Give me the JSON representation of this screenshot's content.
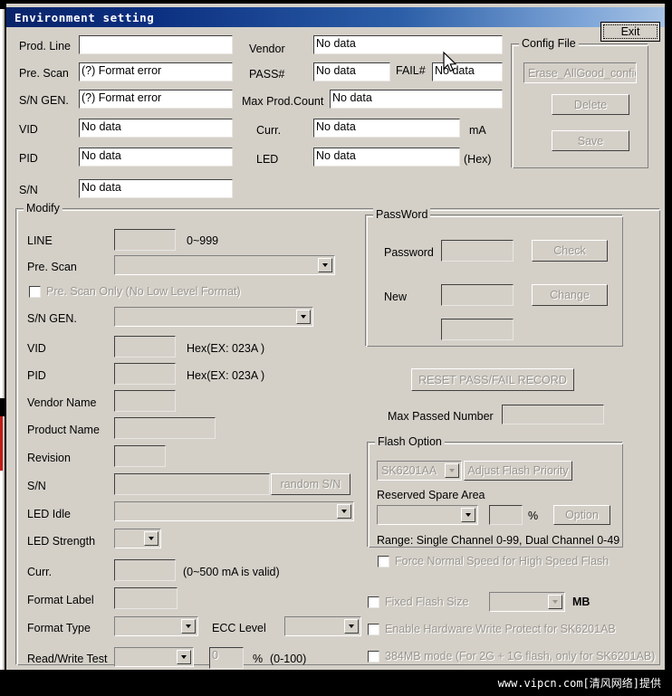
{
  "window": {
    "title": "Environment setting"
  },
  "exit_button": {
    "label": "Exit"
  },
  "top": {
    "prod_line": {
      "label": "Prod. Line",
      "value": ""
    },
    "pre_scan": {
      "label": "Pre. Scan",
      "value": "(?) Format error"
    },
    "sn_gen": {
      "label": "S/N GEN.",
      "value": "(?) Format error"
    },
    "vid": {
      "label": "VID",
      "value": "No data"
    },
    "pid": {
      "label": "PID",
      "value": "No data"
    },
    "sn": {
      "label": "S/N",
      "value": "No data"
    },
    "vendor": {
      "label": "Vendor",
      "value": "No data"
    },
    "pass_num": {
      "label": "PASS#",
      "value": "No data"
    },
    "fail_num": {
      "label": "FAIL#",
      "value": "No data"
    },
    "max_prod_count": {
      "label": "Max Prod.Count",
      "value": "No data"
    },
    "curr": {
      "label": "Curr.",
      "value": "No data",
      "unit": "mA"
    },
    "led": {
      "label": "LED",
      "value": "No data",
      "unit": "(Hex)"
    }
  },
  "config_file": {
    "title": "Config File",
    "combo_value": "Erase_AllGood_config",
    "delete_label": "Delete",
    "save_label": "Save"
  },
  "modify": {
    "title": "Modify",
    "line": {
      "label": "LINE",
      "value": "",
      "hint": "0~999"
    },
    "pre_scan": {
      "label": "Pre. Scan",
      "value": ""
    },
    "pre_scan_only": {
      "label": "Pre. Scan Only (No Low Level Format)",
      "checked": false
    },
    "sn_gen": {
      "label": "S/N GEN.",
      "value": ""
    },
    "vid": {
      "label": "VID",
      "value": "",
      "hint": "Hex(EX: 023A )"
    },
    "pid": {
      "label": "PID",
      "value": "",
      "hint": "Hex(EX: 023A )"
    },
    "vendor_name": {
      "label": "Vendor Name",
      "value": ""
    },
    "product_name": {
      "label": "Product Name",
      "value": ""
    },
    "revision": {
      "label": "Revision",
      "value": ""
    },
    "sn": {
      "label": "S/N",
      "value": "",
      "button": "random S/N"
    },
    "led_idle": {
      "label": "LED Idle",
      "value": ""
    },
    "led_strength": {
      "label": "LED Strength",
      "value": ""
    },
    "curr": {
      "label": "Curr.",
      "value": "",
      "hint": "(0~500 mA is valid)"
    },
    "format_label": {
      "label": "Format Label",
      "value": ""
    },
    "format_type": {
      "label": "Format Type",
      "value": ""
    },
    "ecc_level": {
      "label": "ECC Level",
      "value": ""
    },
    "read_write_test": {
      "label": "Read/Write Test",
      "value": "",
      "percent": "0",
      "percent_sign": "%",
      "range": "(0-100)"
    }
  },
  "password": {
    "title": "PassWord",
    "password_label": "Password",
    "password_value": "",
    "check_label": "Check",
    "new_label": "New",
    "new_value": "",
    "confirm_value": "",
    "change_label": "Change"
  },
  "reset": {
    "button_label": "RESET PASS/FAIL RECORD",
    "max_passed_label": "Max Passed Number",
    "max_passed_value": ""
  },
  "flash_option": {
    "title": "Flash Option",
    "chip_value": "SK6201AA",
    "adjust_label": "Adjust Flash Priority",
    "reserved_label": "Reserved Spare Area",
    "reserved_value": "",
    "percent_value": "",
    "percent_sign": "%",
    "option_label": "Option",
    "range_text": "Range: Single Channel 0-99, Dual Channel 0-49",
    "force_normal_speed": {
      "label": "Force Normal Speed for High Speed Flash",
      "checked": false
    }
  },
  "bottom_options": {
    "fixed_flash_size": {
      "label": "Fixed Flash Size",
      "checked": false,
      "value": "",
      "unit": "MB"
    },
    "hw_write_protect": {
      "label": "Enable Hardware Write Protect for SK6201AB",
      "checked": false
    },
    "mode_384mb": {
      "label": "384MB mode (For 2G + 1G flash, only for SK6201AB)",
      "checked": false
    }
  },
  "watermark": {
    "text": "www.vipcn.com[清风网络]提供"
  }
}
